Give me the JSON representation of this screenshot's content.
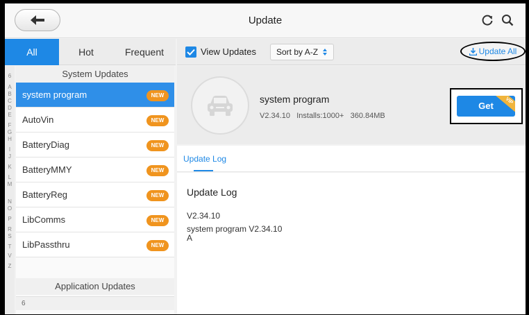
{
  "header": {
    "title": "Update"
  },
  "tabs": [
    {
      "label": "All",
      "active": true
    },
    {
      "label": "Hot",
      "active": false
    },
    {
      "label": "Frequent",
      "active": false
    }
  ],
  "toolbar": {
    "view_updates_label": "View Updates",
    "view_updates_checked": true,
    "sort_label": "Sort by A-Z",
    "update_all_label": "Update All"
  },
  "alphabet": [
    "6",
    "A",
    "B",
    "C",
    "D",
    "E",
    "F",
    "G",
    "H",
    "I",
    "J",
    "K",
    "L",
    "M",
    "N",
    "O",
    "P",
    "R",
    "S",
    "T",
    "V",
    "Z"
  ],
  "list": {
    "system_header": "System Updates",
    "items": [
      {
        "name": "system program",
        "badge": "NEW",
        "selected": true
      },
      {
        "name": "AutoVin",
        "badge": "NEW"
      },
      {
        "name": "BatteryDiag",
        "badge": "NEW"
      },
      {
        "name": "BatteryMMY",
        "badge": "NEW"
      },
      {
        "name": "BatteryReg",
        "badge": "NEW"
      },
      {
        "name": "LibComms",
        "badge": "NEW"
      },
      {
        "name": "LibPassthru",
        "badge": "NEW"
      }
    ],
    "application_header": "Application Updates",
    "application_first_group": "6"
  },
  "detail": {
    "name": "system program",
    "version": "V2.34.10",
    "installs": "Installs:1000+",
    "size": "360.84MB",
    "get_label": "Get",
    "vip_label": "VIP"
  },
  "log": {
    "tab_label": "Update Log",
    "heading": "Update Log",
    "version": "V2.34.10",
    "text": "system program  V2.34.10\nA"
  },
  "colors": {
    "accent": "#1e88e5",
    "badge": "#f0941e",
    "vip": "#f0b43c"
  }
}
